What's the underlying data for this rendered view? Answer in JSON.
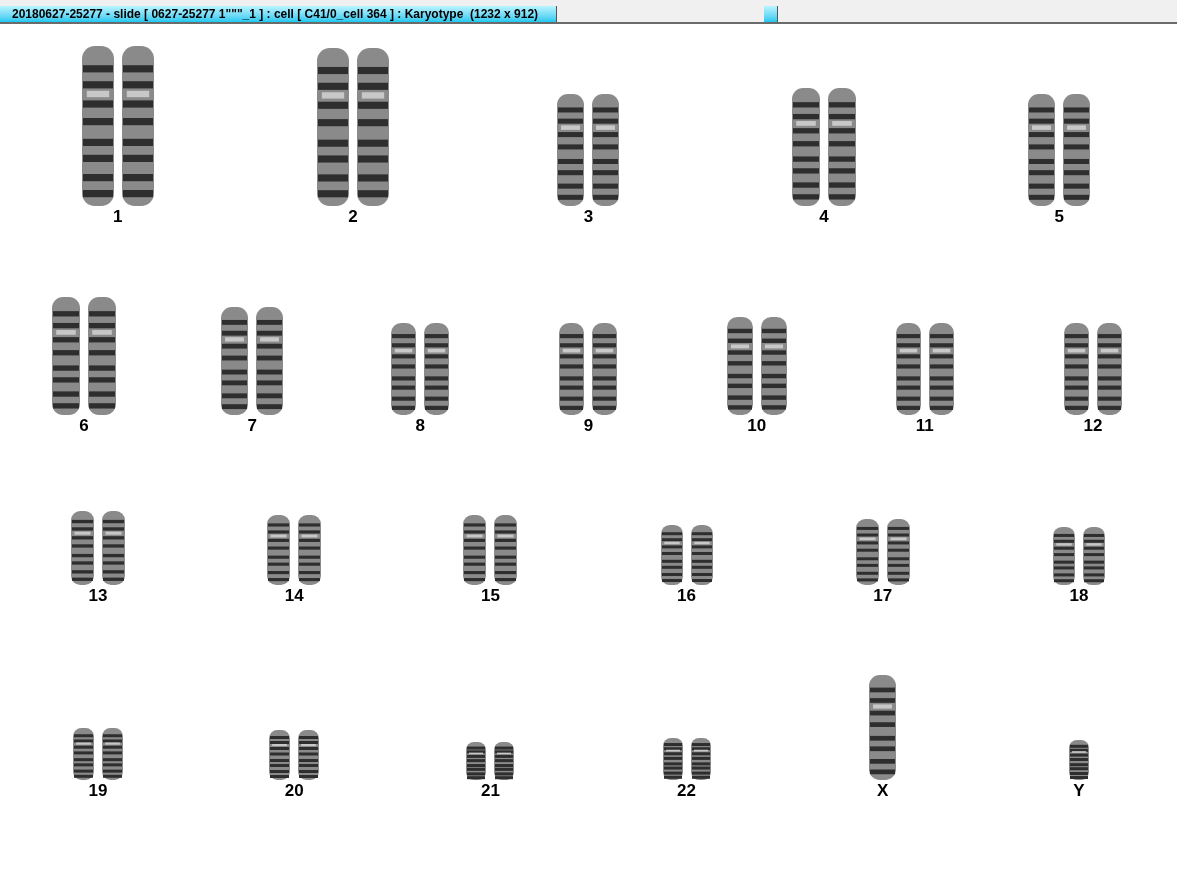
{
  "tab_bar": {
    "tabs": [
      {
        "label": "20180627-25277 - slide [ 0627-25277 1\"\"\"_1 ] : cell [ C41/0_cell 364 ] : Karyotype  (1232 x 912)",
        "selected": true
      }
    ]
  },
  "karyotype": {
    "rows": [
      {
        "chromosomes": [
          {
            "label": "1"
          },
          {
            "label": "2"
          },
          {
            "label": "3"
          },
          {
            "label": "4"
          },
          {
            "label": "5"
          }
        ]
      },
      {
        "chromosomes": [
          {
            "label": "6"
          },
          {
            "label": "7"
          },
          {
            "label": "8"
          },
          {
            "label": "9"
          },
          {
            "label": "10"
          },
          {
            "label": "11"
          },
          {
            "label": "12"
          }
        ]
      },
      {
        "chromosomes": [
          {
            "label": "13"
          },
          {
            "label": "14"
          },
          {
            "label": "15"
          },
          {
            "label": "16"
          },
          {
            "label": "17"
          },
          {
            "label": "18"
          }
        ]
      },
      {
        "chromosomes": [
          {
            "label": "19"
          },
          {
            "label": "20"
          },
          {
            "label": "21"
          },
          {
            "label": "22"
          },
          {
            "label": "X"
          },
          {
            "label": "Y"
          }
        ]
      }
    ]
  }
}
